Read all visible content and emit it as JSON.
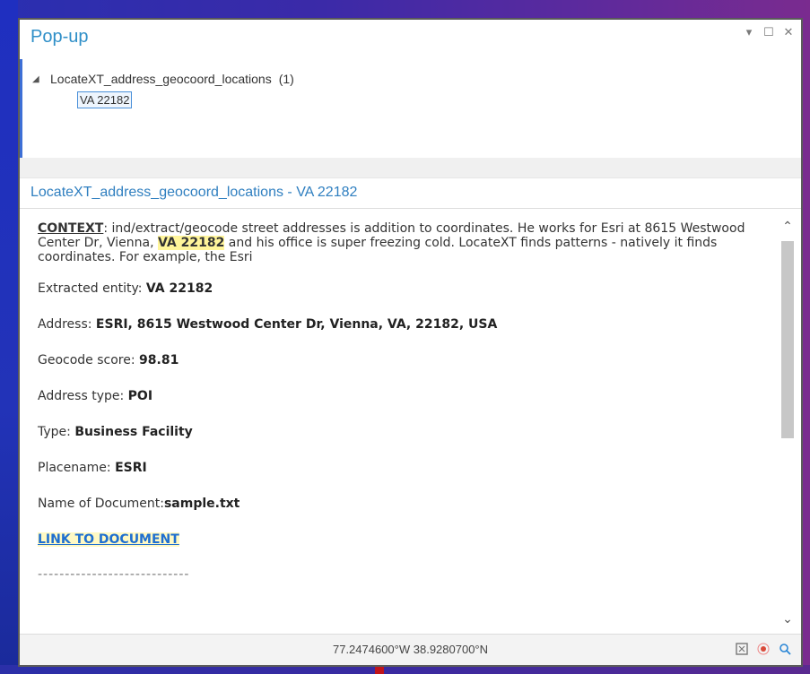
{
  "window": {
    "title": "Pop-up",
    "controls": {
      "menu": "▾",
      "restore": "☐",
      "close": "✕"
    }
  },
  "tree": {
    "layer_label": "LocateXT_address_geocoord_locations",
    "layer_count": "(1)",
    "selected_feature": "VA 22182"
  },
  "header": {
    "text": "LocateXT_address_geocoord_locations - VA 22182"
  },
  "content": {
    "context_label": "CONTEXT",
    "context_text_1": ": ind/extract/geocode street addresses is addition to coordinates. He works for Esri at 8615 Westwood Center Dr, Vienna, ",
    "context_highlight": "VA 22182",
    "context_text_2": " and his office is super freezing cold. LocateXT finds patterns - natively it finds coordinates. For example, the Esri",
    "rows": [
      {
        "label": "Extracted entity: ",
        "value": "VA 22182"
      },
      {
        "label": "Address: ",
        "value": "ESRI, 8615 Westwood Center Dr, Vienna, VA, 22182, USA"
      },
      {
        "label": "Geocode score: ",
        "value": "98.81"
      },
      {
        "label": "Address type: ",
        "value": "POI"
      },
      {
        "label": "Type: ",
        "value": "Business Facility"
      },
      {
        "label": "Placename: ",
        "value": "ESRI"
      },
      {
        "label": "Name of Document:",
        "value": "sample.txt"
      }
    ],
    "link_text": "LINK TO DOCUMENT",
    "separator": "----------------------------"
  },
  "status": {
    "coordinates": "77.2474600°W 38.9280700°N"
  },
  "icons": {
    "grid": "grid-icon",
    "flash": "flash-icon",
    "zoom": "zoom-icon"
  }
}
